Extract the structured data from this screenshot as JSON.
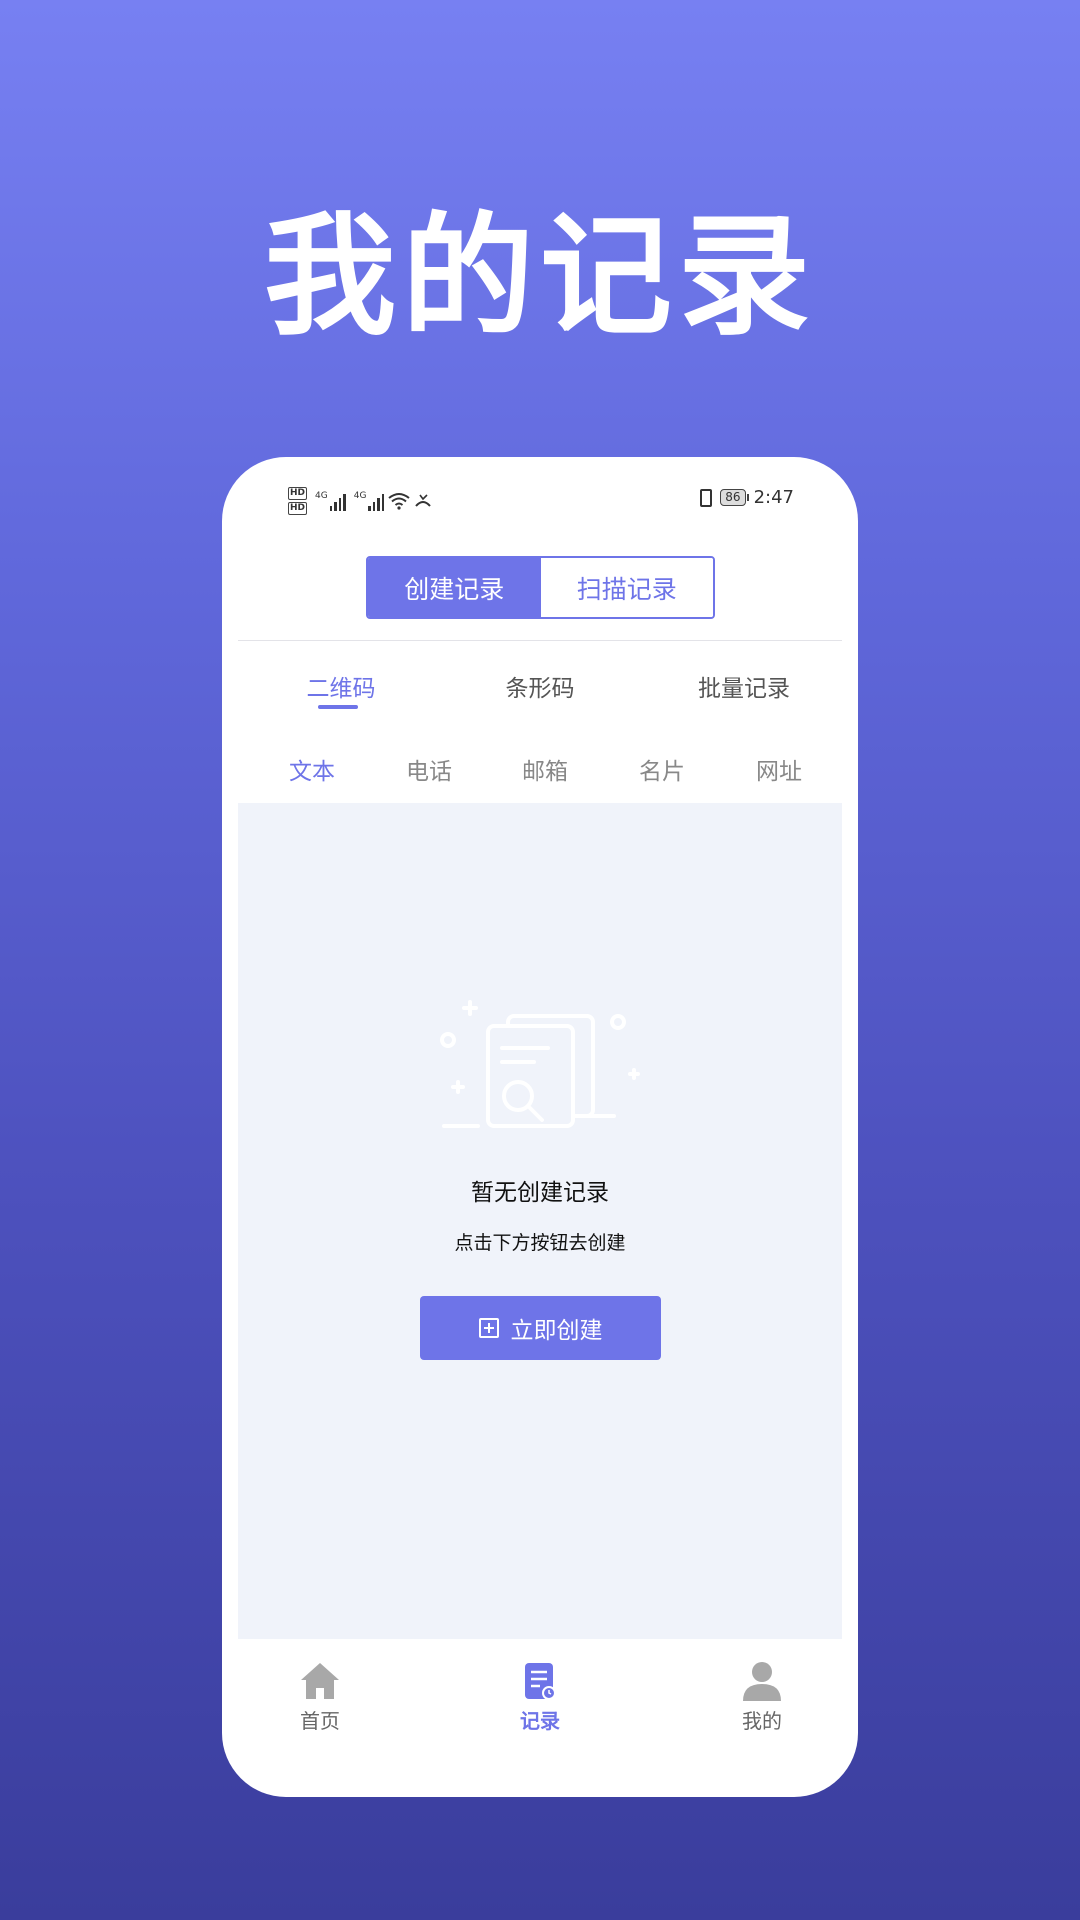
{
  "headline": "我的记录",
  "status_bar": {
    "hd_labels": [
      "HD",
      "HD"
    ],
    "network": [
      "4G",
      "4G"
    ],
    "battery": "86",
    "time": "2:47"
  },
  "segment": {
    "create_records": "创建记录",
    "scan_records": "扫描记录"
  },
  "categories": [
    {
      "label": "二维码",
      "active": true
    },
    {
      "label": "条形码",
      "active": false
    },
    {
      "label": "批量记录",
      "active": false
    }
  ],
  "sub_tabs": [
    {
      "label": "文本",
      "active": true
    },
    {
      "label": "电话",
      "active": false
    },
    {
      "label": "邮箱",
      "active": false
    },
    {
      "label": "名片",
      "active": false
    },
    {
      "label": "网址",
      "active": false
    }
  ],
  "empty_state": {
    "title": "暂无创建记录",
    "subtitle": "点击下方按钮去创建",
    "button_label": "立即创建"
  },
  "bottom_nav": [
    {
      "label": "首页",
      "icon": "home-icon",
      "active": false
    },
    {
      "label": "记录",
      "icon": "records-icon",
      "active": true
    },
    {
      "label": "我的",
      "icon": "profile-icon",
      "active": false
    }
  ],
  "colors": {
    "accent": "#6e74e8",
    "panel_bg": "#f0f3fa",
    "nav_inactive": "#a8a8a8"
  }
}
